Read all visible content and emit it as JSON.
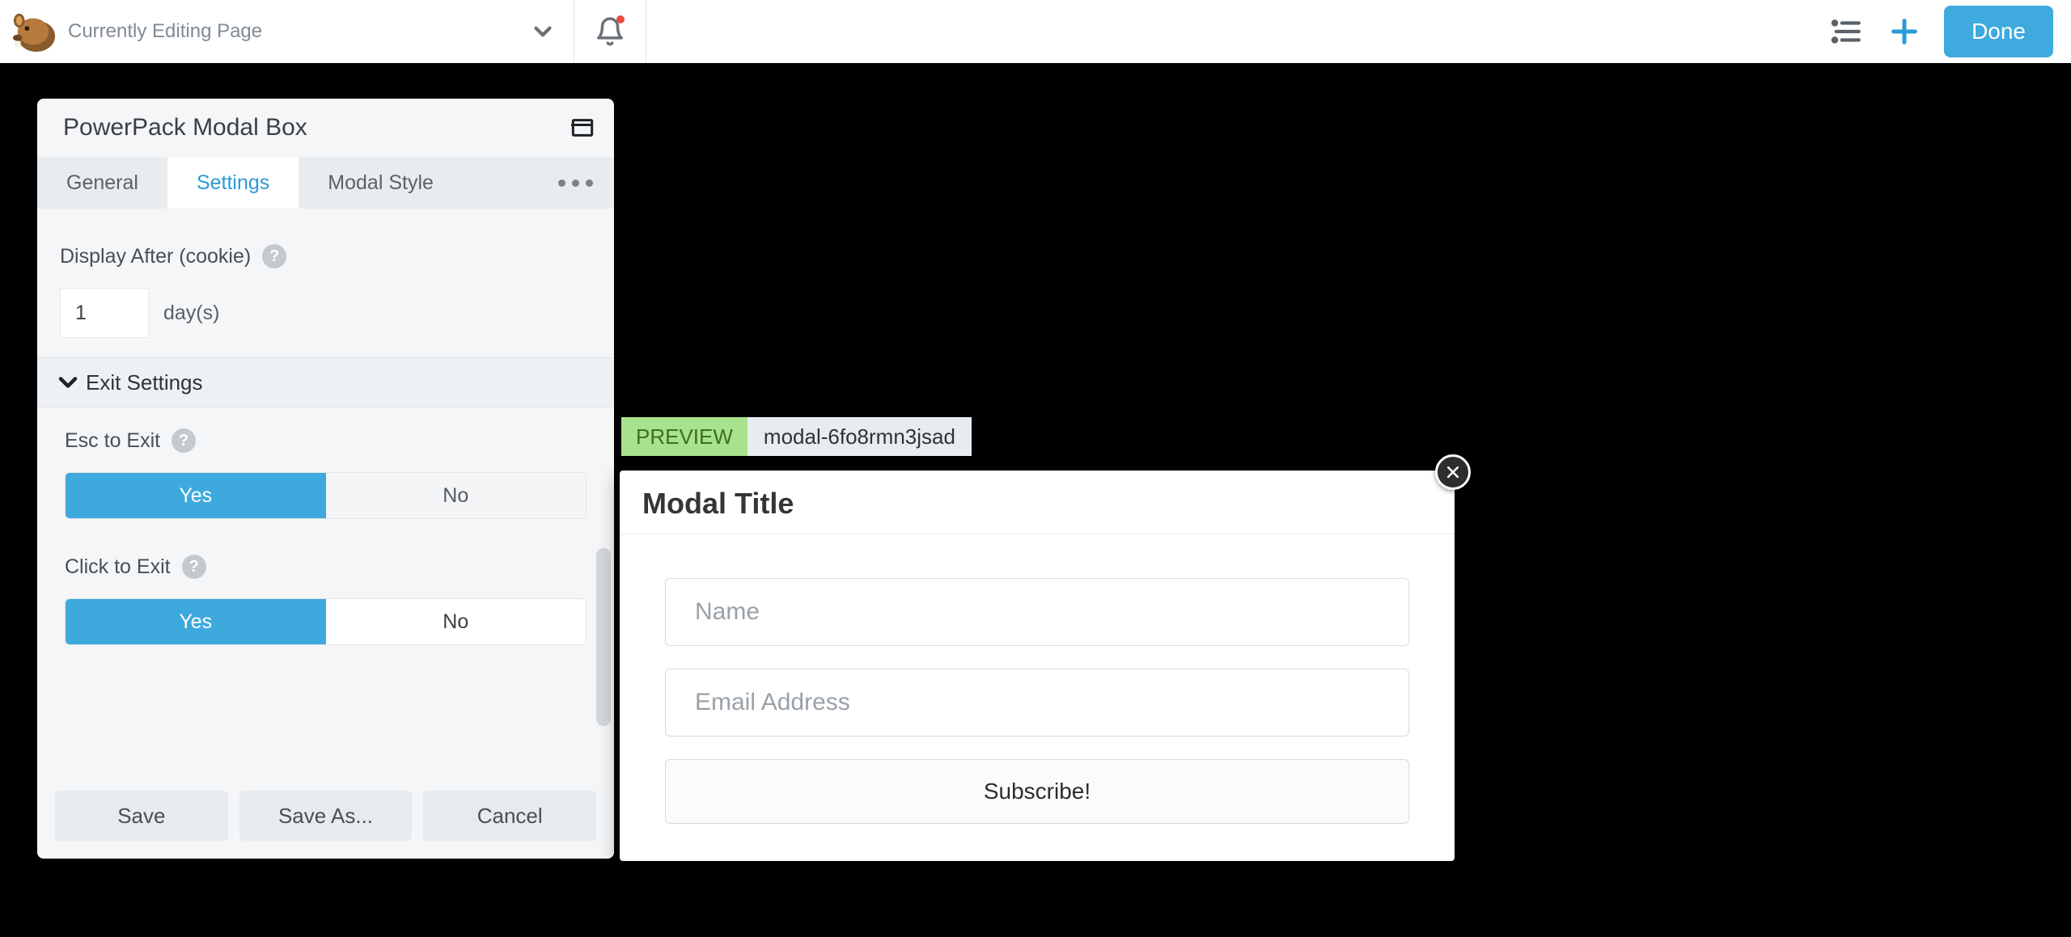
{
  "topbar": {
    "page_title": "Currently Editing Page",
    "done_label": "Done"
  },
  "panel": {
    "title": "PowerPack Modal Box",
    "tabs": {
      "general": "General",
      "settings": "Settings",
      "modal_style": "Modal Style"
    },
    "display_after": {
      "label": "Display After (cookie)",
      "value": "1",
      "unit": "day(s)"
    },
    "exit_section": {
      "title": "Exit Settings",
      "esc_label": "Esc to Exit",
      "click_label": "Click to Exit",
      "yes": "Yes",
      "no": "No"
    },
    "footer": {
      "save": "Save",
      "save_as": "Save As...",
      "cancel": "Cancel"
    }
  },
  "preview": {
    "tag": "PREVIEW",
    "id": "modal-6fo8rmn3jsad",
    "modal_title": "Modal Title",
    "name_placeholder": "Name",
    "email_placeholder": "Email Address",
    "subscribe_label": "Subscribe!"
  }
}
